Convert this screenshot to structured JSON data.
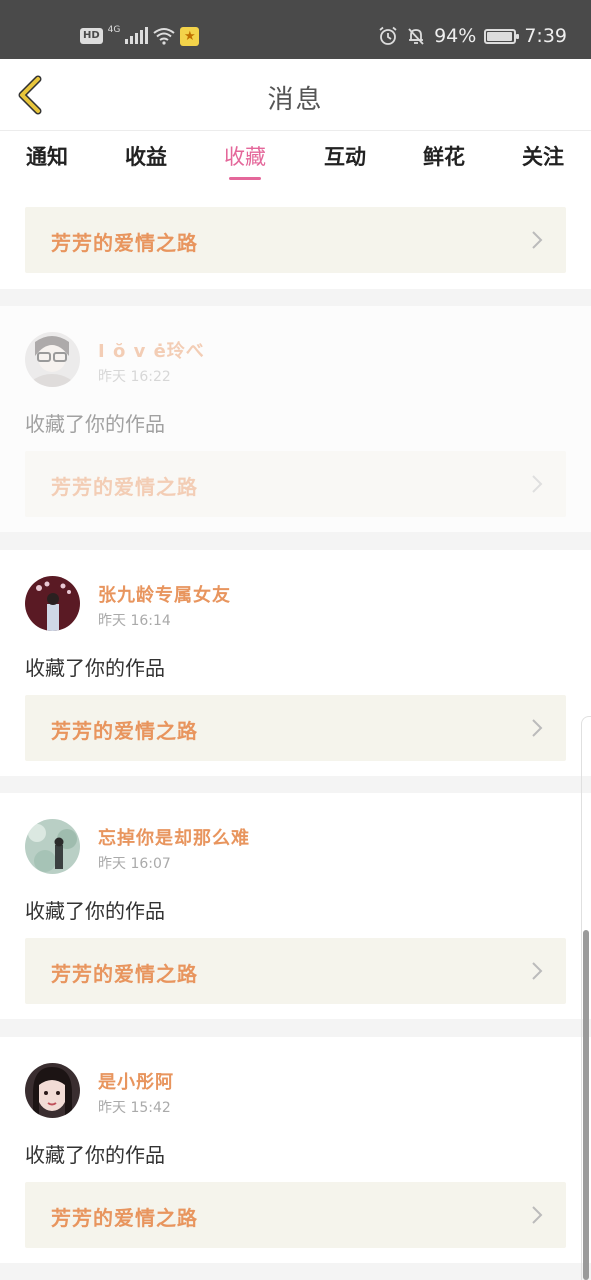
{
  "status_bar": {
    "hd": "HD",
    "network": "4G",
    "battery_text": "94%",
    "battery_level": 0.94,
    "time": "7:39"
  },
  "header": {
    "title": "消息",
    "back_icon": "chevron-left-icon",
    "accent_color": "#e8c53a"
  },
  "tabs": {
    "active_index": 2,
    "active_color": "#e4679a",
    "items": [
      {
        "label": "通知"
      },
      {
        "label": "收益"
      },
      {
        "label": "收藏"
      },
      {
        "label": "互动"
      },
      {
        "label": "鲜花"
      },
      {
        "label": "关注"
      }
    ]
  },
  "top_card": {
    "work_title": "芳芳的爱情之路"
  },
  "items": [
    {
      "username": "I ŏ v ė玲べ",
      "time": "昨天 16:22",
      "action": "收藏了你的作品",
      "work_title": "芳芳的爱情之路"
    },
    {
      "username": "张九龄专属女友",
      "time": "昨天 16:14",
      "action": "收藏了你的作品",
      "work_title": "芳芳的爱情之路"
    },
    {
      "username": "忘掉你是却那么难",
      "time": "昨天 16:07",
      "action": "收藏了你的作品",
      "work_title": "芳芳的爱情之路"
    },
    {
      "username": "是小彤阿",
      "time": "昨天 15:42",
      "action": "收藏了你的作品",
      "work_title": "芳芳的爱情之路"
    }
  ],
  "colors": {
    "name_color": "#e8955e",
    "card_bg": "#f5f4ec",
    "status_bar_bg": "#4a4a4a"
  }
}
